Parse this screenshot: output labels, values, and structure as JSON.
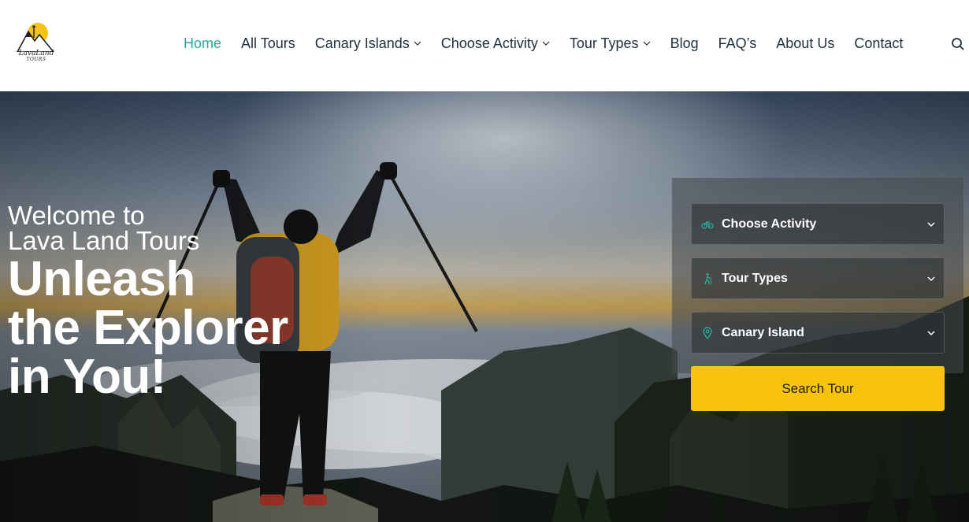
{
  "brand": {
    "logo_lines": [
      "LavaLand",
      "TOURS"
    ],
    "accent_color": "#2aa89a",
    "button_color": "#f7c30b"
  },
  "nav": {
    "items": [
      {
        "label": "Home",
        "active": true,
        "dropdown": false
      },
      {
        "label": "All Tours",
        "active": false,
        "dropdown": false
      },
      {
        "label": "Canary Islands",
        "active": false,
        "dropdown": true
      },
      {
        "label": "Choose Activity",
        "active": false,
        "dropdown": true
      },
      {
        "label": "Tour Types",
        "active": false,
        "dropdown": true
      },
      {
        "label": "Blog",
        "active": false,
        "dropdown": false
      },
      {
        "label": "FAQ’s",
        "active": false,
        "dropdown": false
      },
      {
        "label": "About Us",
        "active": false,
        "dropdown": false
      },
      {
        "label": "Contact",
        "active": false,
        "dropdown": false
      }
    ],
    "search_icon": "search-icon",
    "dropdown_icon": "chevron-down-icon"
  },
  "hero": {
    "welcome_line1": "Welcome to",
    "welcome_line2": "Lava Land Tours",
    "headline_line1": "Unleash",
    "headline_line2": "the Explorer",
    "headline_line3": "in You!"
  },
  "search": {
    "activity": {
      "label": "Choose Activity",
      "icon": "bicycle-icon"
    },
    "tour_types": {
      "label": "Tour Types",
      "icon": "hiker-icon"
    },
    "island": {
      "label": "Canary Island",
      "icon": "map-pin-icon"
    },
    "button_label": "Search Tour"
  }
}
